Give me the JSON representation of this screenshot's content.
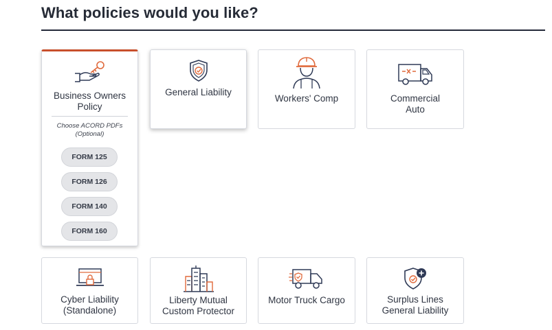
{
  "heading": "What policies would you like?",
  "acord": {
    "note": "Choose ACORD PDFs (Optional)",
    "forms": [
      "FORM 125",
      "FORM 126",
      "FORM 140",
      "FORM 160"
    ]
  },
  "policies": [
    {
      "label_lines": [
        "Business Owners",
        "Policy"
      ],
      "icon": "hand-with-key-icon",
      "selected": true
    },
    {
      "label_lines": [
        "General Liability"
      ],
      "icon": "shield-check-icon"
    },
    {
      "label_lines": [
        "Workers' Comp"
      ],
      "icon": "worker-hardhat-icon"
    },
    {
      "label_lines": [
        "Commercial",
        "Auto"
      ],
      "icon": "delivery-van-icon"
    },
    {
      "label_lines": [
        "Cyber Liability",
        "(Standalone)"
      ],
      "icon": "laptop-lock-icon"
    },
    {
      "label_lines": [
        "Liberty Mutual",
        "Custom Protector"
      ],
      "icon": "city-buildings-icon"
    },
    {
      "label_lines": [
        "Motor Truck Cargo"
      ],
      "icon": "cargo-truck-icon"
    },
    {
      "label_lines": [
        "Surplus Lines",
        "General Liability"
      ],
      "icon": "shield-plus-icon"
    }
  ],
  "colors": {
    "accent": "#c84f2b",
    "ink": "#2f3a56",
    "border": "#d5d8de",
    "pill": "#e4e5e8"
  }
}
